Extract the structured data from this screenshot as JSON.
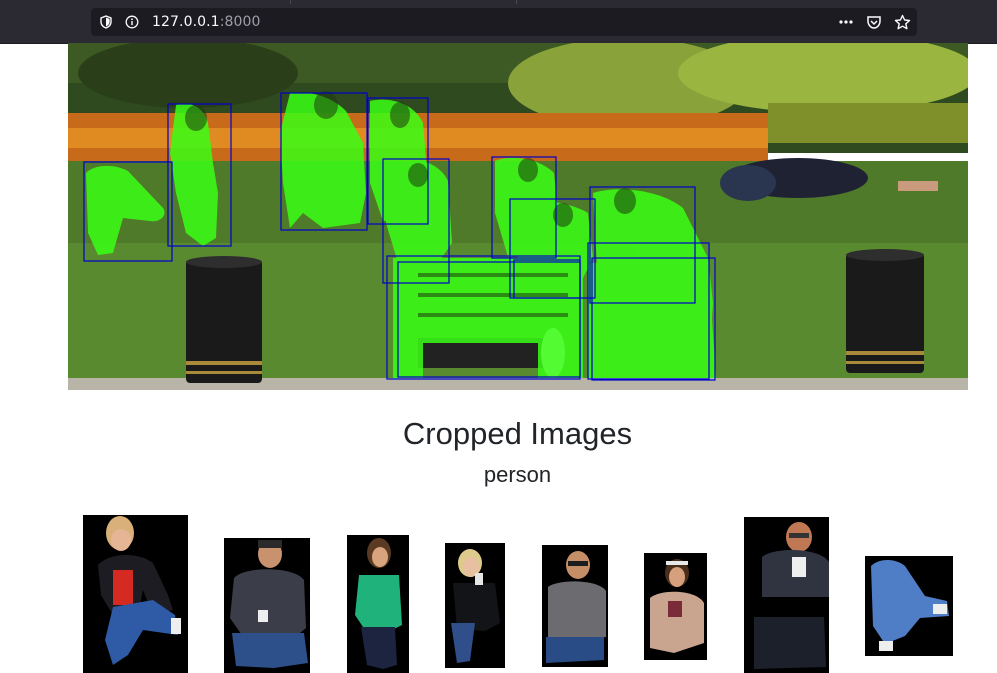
{
  "browser": {
    "url_host": "127.0.0.1",
    "url_port": ":8000",
    "icons": [
      "shield-icon",
      "info-icon",
      "more-icon",
      "pocket-icon",
      "bookmark-star-icon"
    ]
  },
  "main": {
    "image_alt": "detection result",
    "box_color": "#0000cc",
    "mask_color": "#39ff14"
  },
  "crops": {
    "title": "Cropped Images",
    "label": "person"
  }
}
